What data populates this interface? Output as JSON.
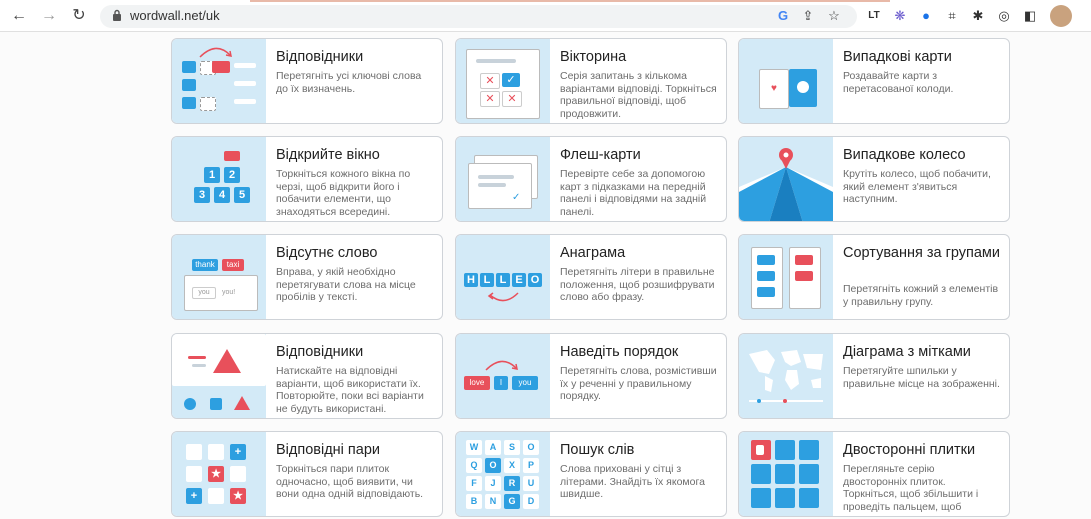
{
  "browser": {
    "url": "wordwall.net/uk"
  },
  "cards": [
    {
      "title": "Відповідники",
      "desc": "Перетягніть усі ключові слова до їх визначень."
    },
    {
      "title": "Вікторина",
      "desc": "Серія запитань з кількома варіантами відповіді. Торкніться правильної відповіді, щоб продовжити."
    },
    {
      "title": "Випадкові карти",
      "desc": "Роздавайте карти з перетасованої колоди."
    },
    {
      "title": "Відкрийте вікно",
      "desc": "Торкніться кожного вікна по черзі, щоб відкрити його і побачити елементи, що знаходяться всередині."
    },
    {
      "title": "Флеш-карти",
      "desc": "Перевірте себе за допомогою карт з підказками на передній панелі і відповідями на задній панелі."
    },
    {
      "title": "Випадкове колесо",
      "desc": "Крутіть колесо, щоб побачити, який елемент з'явиться наступним."
    },
    {
      "title": "Відсутнє слово",
      "desc": "Вправа, у якій необхідно перетягувати слова на місце пробілів у тексті."
    },
    {
      "title": "Анаграма",
      "desc": "Перетягніть літери в правильне положення, щоб розшифрувати слово або фразу."
    },
    {
      "title": "Сортування за групами",
      "desc": "Перетягніть кожний з елементів у правильну групу."
    },
    {
      "title": "Відповідники",
      "desc": "Натискайте на відповідні варіанти, щоб використати їх. Повторюйте, поки всі варіанти не будуть використані."
    },
    {
      "title": "Наведіть порядок",
      "desc": "Перетягніть слова, розмістивши їх у реченні у правильному порядку."
    },
    {
      "title": "Діаграма з мітками",
      "desc": "Перетягуйте шпильки у правильне місце на зображенні."
    },
    {
      "title": "Відповідні пари",
      "desc": "Торкніться пари плиток одночасно, щоб виявити, чи вони одна одній відповідають."
    },
    {
      "title": "Пошук слів",
      "desc": "Слова приховані у сітці з літерами. Знайдіть їх якомога швидше."
    },
    {
      "title": "Двосторонні плитки",
      "desc": "Перегляньте серію двосторонніх плиток. Торкніться, щоб збільшити і проведіть пальцем, щоб"
    }
  ],
  "thumbs": {
    "open_box_numbers": [
      "1",
      "2",
      "3",
      "4",
      "5"
    ],
    "missing_word_chips": [
      "thank",
      "taxi",
      "you!",
      "you"
    ],
    "anagram_letters": [
      "H",
      "L",
      "L",
      "E",
      "O"
    ],
    "order_words": [
      "love",
      "I",
      "you"
    ],
    "wordsearch_letters": [
      "W",
      "A",
      "S",
      "O",
      "Q",
      "O",
      "X",
      "P",
      "F",
      "J",
      "R",
      "U",
      "B",
      "N",
      "G",
      "D"
    ]
  }
}
